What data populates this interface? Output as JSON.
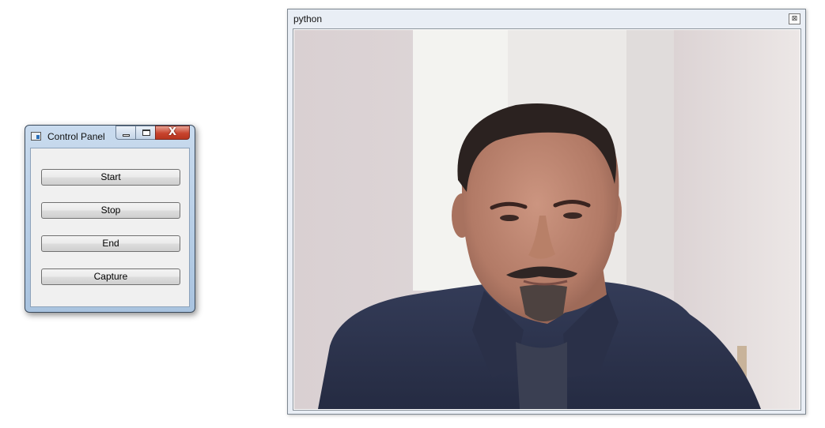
{
  "control_panel": {
    "title": "Control Panel",
    "window_buttons": {
      "close_glyph": "X"
    },
    "buttons": [
      {
        "label": "Start"
      },
      {
        "label": "Stop"
      },
      {
        "label": "End"
      },
      {
        "label": "Capture"
      }
    ]
  },
  "camera_window": {
    "title": "python",
    "close_glyph": "⊠",
    "image": {
      "content": "webcam-frame",
      "colors": {
        "wall": "#e4dcdc",
        "window_light": "#f2f2ef",
        "shirt": "#2c3450",
        "skin": "#b9826c"
      }
    }
  }
}
